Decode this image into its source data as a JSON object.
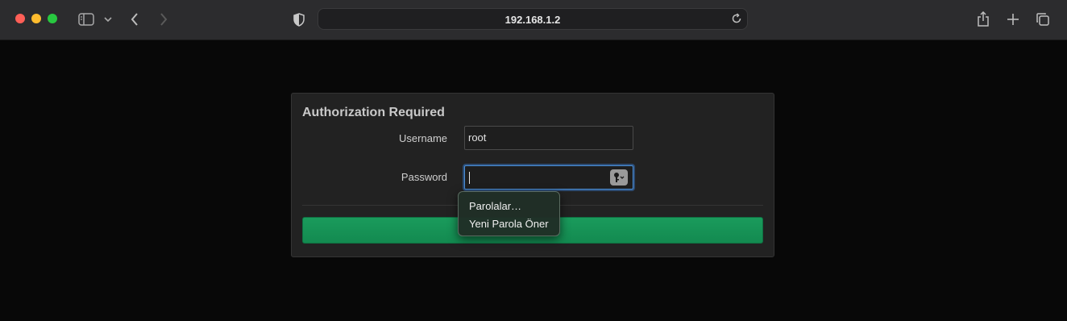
{
  "browser": {
    "url": "192.168.1.2"
  },
  "login": {
    "title": "Authorization Required",
    "username_label": "Username",
    "username_value": "root",
    "password_label": "Password",
    "password_value": ""
  },
  "autofill_menu": {
    "items": [
      "Parolalar…",
      "Yeni Parola Öner"
    ]
  },
  "colors": {
    "submit_button": "#1a9b5c",
    "focus_ring": "#4a8fd8",
    "background": "#080808"
  },
  "icons": [
    "sidebar-icon",
    "chevron-down-icon",
    "back-icon",
    "forward-icon",
    "shield-icon",
    "reload-icon",
    "share-icon",
    "plus-icon",
    "tabs-icon",
    "key-icon"
  ]
}
